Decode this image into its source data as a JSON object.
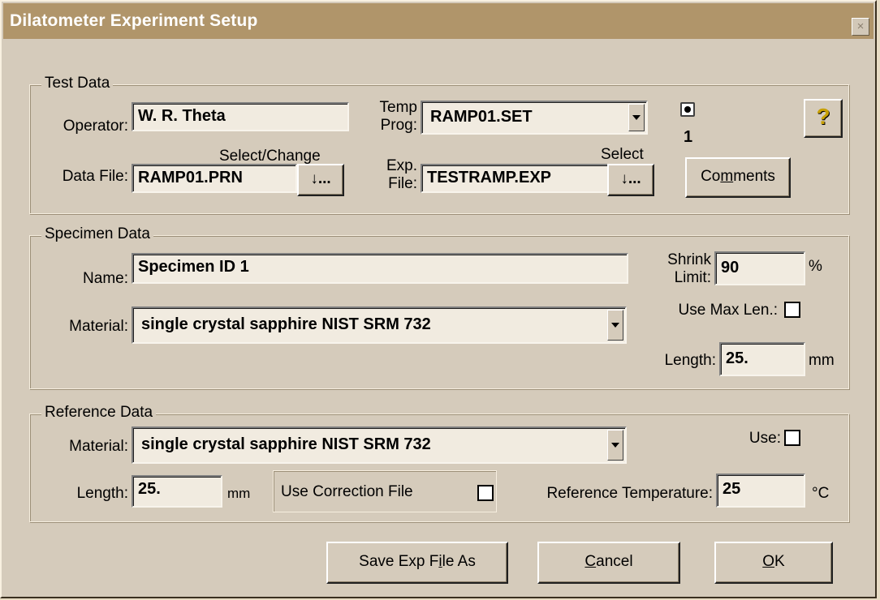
{
  "window": {
    "title": "Dilatometer Experiment Setup",
    "close_glyph": "×"
  },
  "test_data": {
    "legend": "Test Data",
    "operator_label": "Operator:",
    "operator_value": "W. R. Theta",
    "temp_prog_label_1": "Temp",
    "temp_prog_label_2": "Prog:",
    "temp_prog_value": "RAMP01.SET",
    "radio_value": "1",
    "help_glyph": "?",
    "select_change_label": "Select/Change",
    "data_file_label": "Data File:",
    "data_file_value": "RAMP01.PRN",
    "data_file_button": "↓...",
    "exp_label_1": "Exp.",
    "exp_label_2": "File:",
    "select_label": "Select",
    "exp_file_value": "TESTRAMP.EXP",
    "exp_file_button": "↓...",
    "comments_pre": "Co",
    "comments_ul": "m",
    "comments_post": "ments"
  },
  "specimen_data": {
    "legend": "Specimen Data",
    "name_label": "Name:",
    "name_value": "Specimen ID 1",
    "material_label": "Material:",
    "material_value": "single crystal sapphire NIST SRM 732",
    "shrink_label_1": "Shrink",
    "shrink_label_2": "Limit:",
    "shrink_value": "90",
    "shrink_unit": "%",
    "use_max_len_label": "Use Max Len.:",
    "length_label": "Length:",
    "length_value": "25.",
    "length_unit": "mm"
  },
  "reference_data": {
    "legend": "Reference Data",
    "material_label": "Material:",
    "material_value": "single crystal sapphire NIST SRM 732",
    "use_label": "Use:",
    "length_label": "Length:",
    "length_value": "25.",
    "length_unit": "mm",
    "correction_label": "Use Correction File",
    "ref_temp_label": "Reference Temperature:",
    "ref_temp_value": "25",
    "ref_temp_unit": "°C"
  },
  "buttons": {
    "save_pre": "Save Exp F",
    "save_ul": "i",
    "save_post": "le As",
    "cancel_pre": "",
    "cancel_ul": "C",
    "cancel_post": "ancel",
    "ok_pre": "",
    "ok_ul": "O",
    "ok_post": "K"
  }
}
